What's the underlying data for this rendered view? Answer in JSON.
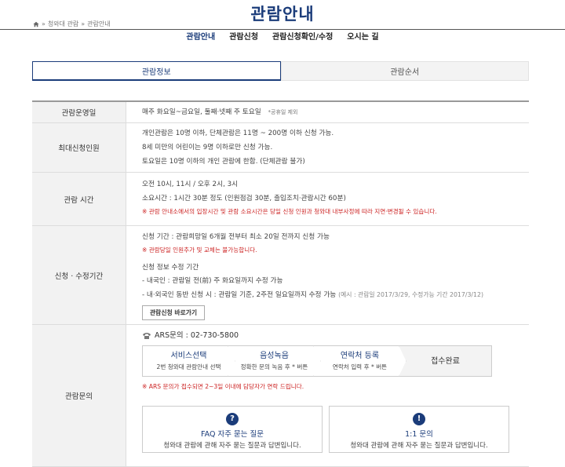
{
  "page_title": "관람안내",
  "breadcrumb": [
    "청와대 관람",
    "관람안내"
  ],
  "subnav": [
    "관람안내",
    "관람신청",
    "관람신청확인/수정",
    "오시는 길"
  ],
  "tabs": [
    "관람정보",
    "관람순서"
  ],
  "rows": {
    "operating_day": {
      "label": "관람운영일",
      "text": "매주 화요일~금요일, 둘째·넷째 주 토요일",
      "note": "*공휴일 제외"
    },
    "max_people": {
      "label": "최대신청인원",
      "lines": [
        "개인관람은 10명 이하, 단체관람은 11명 ~ 200명 이하 신청 가능.",
        "8세 미만의 어린이는 9명 이하로만 신청 가능.",
        "토요일은 10명 이하의 개인 관람에 한함. (단체관람 불가)"
      ]
    },
    "time": {
      "label": "관람 시간",
      "lines": [
        "오전 10시, 11시 / 오후 2시, 3시",
        "소요시간 : 1시간 30분 정도 (인원점검 30분, 출입조치·관람시간 60분)"
      ],
      "notice": "※ 관람 안내소에서의 입장시간 및 관람 소요시간은 당일 신청 인원과 청와대 내부사정에 따라 지연·변경될 수 있습니다."
    },
    "apply": {
      "label": "신청 · 수정기간",
      "line1": "신청 기간 : 관람희망일 6개월 전부터 최소 20일 전까지 신청 가능",
      "notice": "※ 관람당일 인원추가 및 교체는 불가능합니다.",
      "line2": "신청 정보 수정 기간",
      "line3": "- 내국인 : 관람일 전(前) 주 화요일까지 수정 가능",
      "line4": "- 내·외국인 동반 신청 시 : 관람일 기준, 2주전 일요일까지 수정 가능",
      "line4_example": "(예시 : 관람일 2017/3/29, 수정가능 기간 2017/3/12)",
      "button": "관람신청 바로가기"
    },
    "inquiry": {
      "label": "관람문의",
      "ars": "ARS문의 : 02-730-5800",
      "steps": [
        {
          "title": "서비스선택",
          "desc": "2번 청와대 관람안내 선택"
        },
        {
          "title": "음성녹음",
          "desc": "정확한 문의 녹음 후 * 버튼"
        },
        {
          "title": "연락처 등록",
          "desc": "연락처 입력 후 * 버튼"
        },
        {
          "title": "접수완료",
          "desc": ""
        }
      ],
      "notice": "※ ARS 문의가 접수되면 2~3일 이내에 담당자가 연락 드립니다.",
      "cards": [
        {
          "icon": "?",
          "title": "FAQ 자주 묻는 질문",
          "desc": "청와대 관람에 관해 자주 묻는 질문과 답변입니다."
        },
        {
          "icon": "!",
          "title": "1:1 문의",
          "desc": "청와대 관람에 관해 자주 묻는 질문과 답변입니다."
        }
      ]
    }
  },
  "colors": {
    "accent": "#1b3c7a",
    "notice": "#cc2222"
  }
}
